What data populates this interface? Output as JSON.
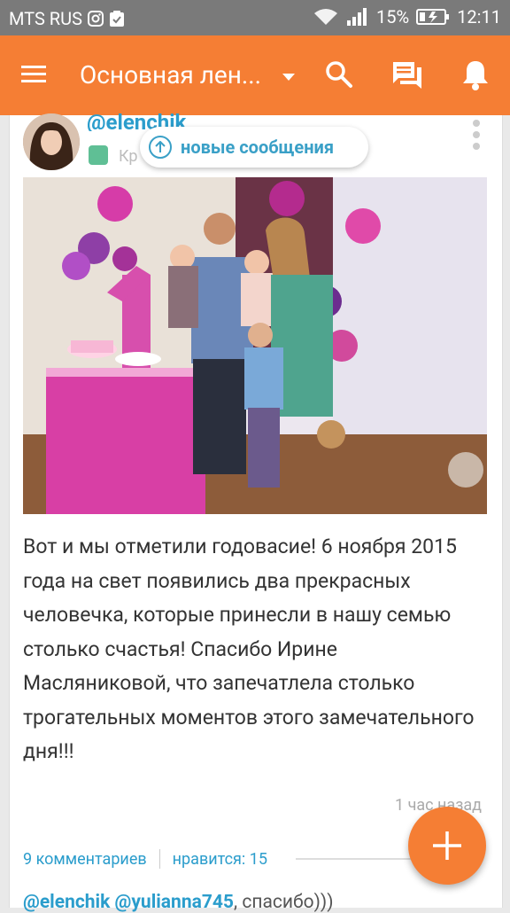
{
  "status_bar": {
    "carrier": "MTS RUS",
    "battery": "15%",
    "time": "12:11"
  },
  "app_bar": {
    "title": "Основная лен...",
    "icons": [
      "menu-icon",
      "dropdown-icon",
      "search-icon",
      "messages-icon",
      "notifications-icon"
    ]
  },
  "post": {
    "author": "@elenchik",
    "group_label": "Кр",
    "new_messages_label": "новые сообщения",
    "text": "Вот и мы отметили годовасие! 6 ноября 2015 года на свет появились два прекрасных человечка, которые принесли в нашу семью столько счастья! Спасибо Ирине Масляниковой, что запечатлела столько трогательных моментов  этого замечательного дня!!!",
    "time": "1 час назад",
    "comments_label": "9 комментариев",
    "likes_label": "нравится: 15"
  },
  "comment": {
    "mentions": "@elenchik @yulianna745",
    "text": ", спасибо)))"
  },
  "colors": {
    "accent": "#f57e34",
    "link": "#2b9dcc",
    "status_bar": "#7a7a7a"
  }
}
